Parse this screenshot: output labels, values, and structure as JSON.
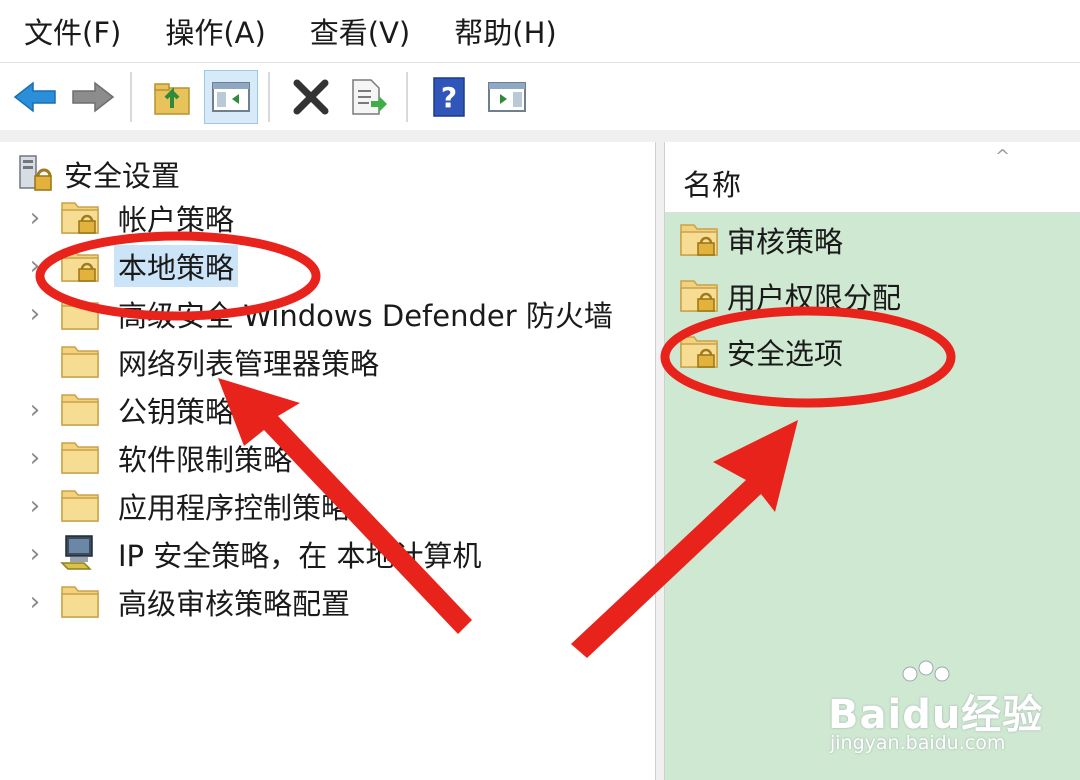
{
  "menu": [
    "文件(F)",
    "操作(A)",
    "查看(V)",
    "帮助(H)"
  ],
  "toolbar": {
    "buttons": [
      {
        "name": "back-arrow-icon",
        "active": false
      },
      {
        "name": "forward-arrow-icon",
        "active": false
      },
      {
        "name": "up-folder-icon",
        "active": false
      },
      {
        "name": "show-hide-tree-icon",
        "active": true
      },
      {
        "name": "delete-x-icon",
        "active": false
      },
      {
        "name": "export-list-icon",
        "active": false
      },
      {
        "name": "help-icon",
        "active": false
      },
      {
        "name": "action-pane-icon",
        "active": false
      }
    ]
  },
  "tree": {
    "root": "安全设置",
    "items": [
      {
        "label": "帐户策略",
        "expandable": true,
        "selected": false,
        "icon": "folder-lock"
      },
      {
        "label": "本地策略",
        "expandable": true,
        "selected": true,
        "icon": "folder-lock"
      },
      {
        "label": "高级安全 Windows Defender 防火墙",
        "expandable": true,
        "selected": false,
        "icon": "folder"
      },
      {
        "label": "网络列表管理器策略",
        "expandable": false,
        "selected": false,
        "icon": "folder"
      },
      {
        "label": "公钥策略",
        "expandable": true,
        "selected": false,
        "icon": "folder"
      },
      {
        "label": "软件限制策略",
        "expandable": true,
        "selected": false,
        "icon": "folder"
      },
      {
        "label": "应用程序控制策略",
        "expandable": true,
        "selected": false,
        "icon": "folder"
      },
      {
        "label": "IP 安全策略，在 本地计算机",
        "expandable": true,
        "selected": false,
        "icon": "computer-shield"
      },
      {
        "label": "高级审核策略配置",
        "expandable": true,
        "selected": false,
        "icon": "folder"
      }
    ]
  },
  "list": {
    "column_header": "名称",
    "items": [
      "审核策略",
      "用户权限分配",
      "安全选项"
    ]
  },
  "watermark": {
    "brand": "Baidu经验",
    "url": "jingyan.baidu.com"
  },
  "colors": {
    "annotation_red": "#e8231c",
    "right_pane_bg": "#cfe8d1",
    "selection": "#cce4f7"
  }
}
